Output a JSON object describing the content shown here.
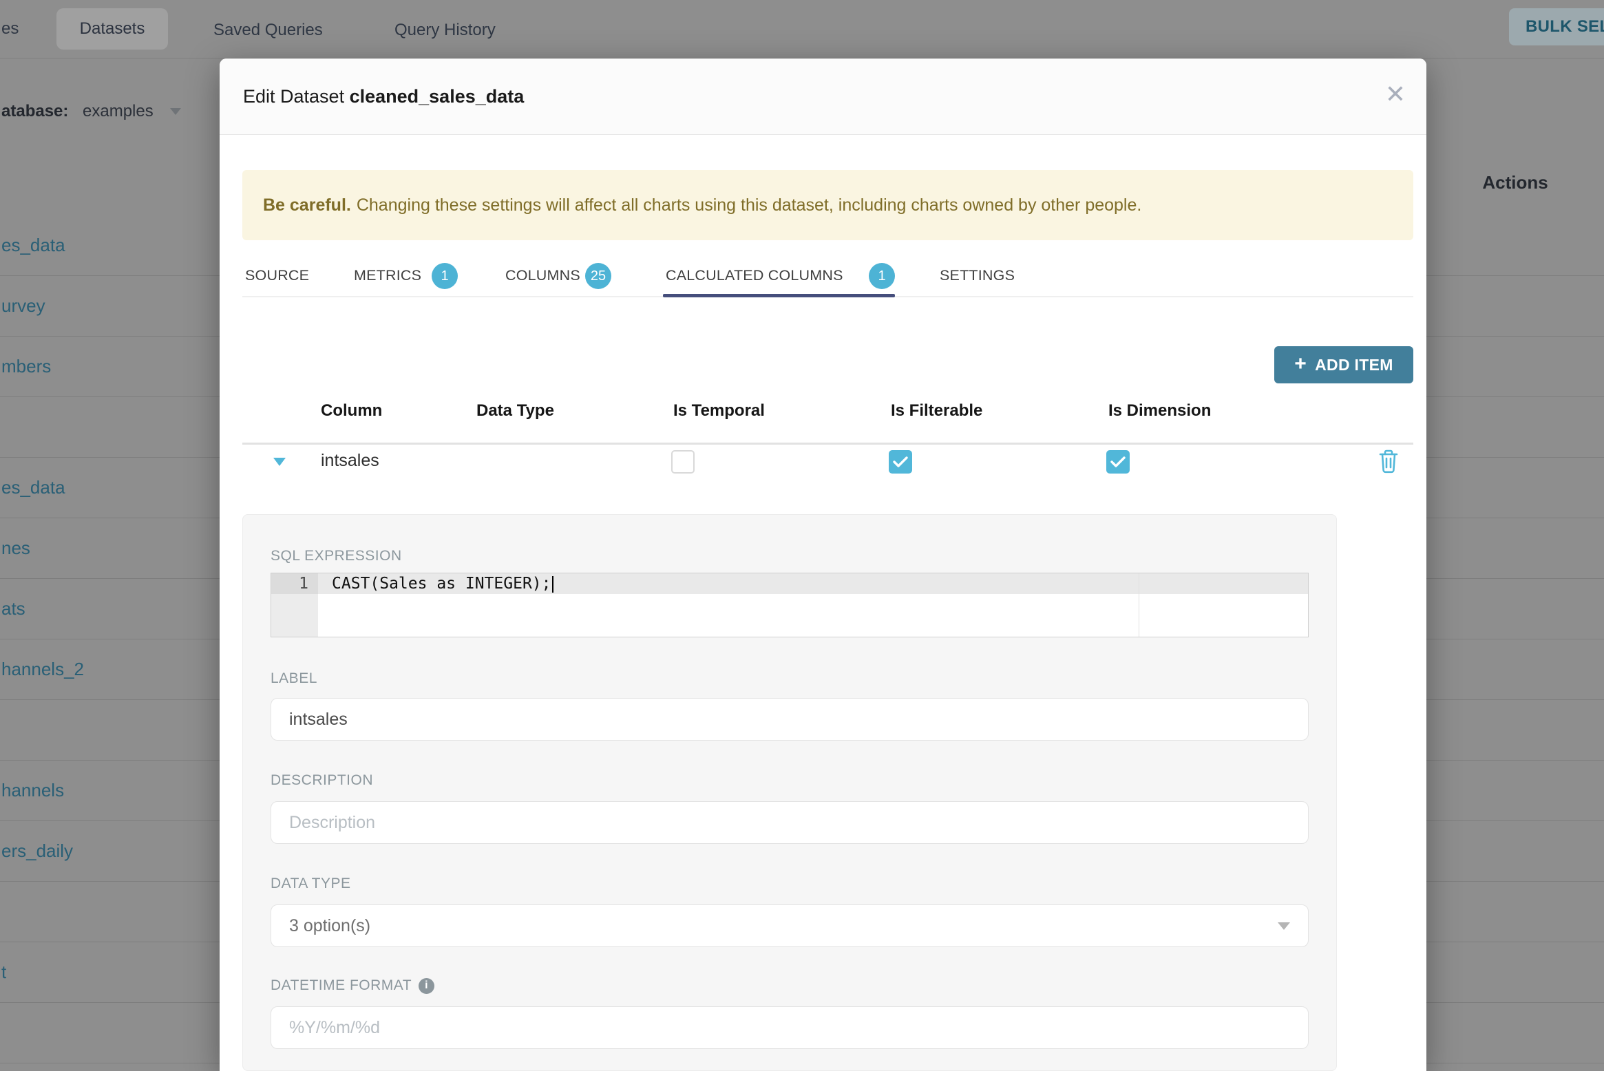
{
  "colors": {
    "accent_cyan": "#51b7d9",
    "badge": "#4db3d5",
    "tab_underline": "#454e7c",
    "add_button": "#427f9b",
    "warning_bg": "#faf5e1",
    "warning_text": "#7f6d28",
    "link_teal_dimmed": "#295f76"
  },
  "background": {
    "nav": {
      "clipped_left_label": "es",
      "tabs": [
        {
          "label": "Datasets"
        },
        {
          "label": "Saved Queries"
        },
        {
          "label": "Query History"
        }
      ],
      "bulk_select_label": "BULK SELEC"
    },
    "filter": {
      "label": "atabase:",
      "value": "examples"
    },
    "actions_header": "Actions",
    "list_rows": [
      "es_data",
      "urvey",
      "mbers",
      "",
      "es_data",
      "nes",
      "ats",
      "hannels_2",
      "",
      "hannels",
      "ers_daily",
      "",
      "t",
      ""
    ]
  },
  "modal": {
    "title_prefix": "Edit Dataset",
    "title_name": "cleaned_sales_data",
    "close_glyph": "✕",
    "warning": {
      "bold": "Be careful.",
      "text": "Changing these settings will affect all charts using this dataset, including charts owned by other people."
    },
    "tabs": [
      {
        "label": "SOURCE",
        "badge": ""
      },
      {
        "label": "METRICS",
        "badge": "1"
      },
      {
        "label": "COLUMNS",
        "badge": "25"
      },
      {
        "label": "CALCULATED COLUMNS",
        "badge": "1"
      },
      {
        "label": "SETTINGS",
        "badge": ""
      }
    ],
    "active_tab": "CALCULATED COLUMNS",
    "add_item_label": "ADD ITEM",
    "add_item_plus": "+",
    "table": {
      "headers": [
        "Column",
        "Data Type",
        "Is Temporal",
        "Is Filterable",
        "Is Dimension"
      ],
      "row": {
        "column": "intsales",
        "is_temporal": false,
        "is_filterable": true,
        "is_dimension": true
      }
    },
    "detail": {
      "sql_label": "SQL EXPRESSION",
      "sql_line_number": "1",
      "sql_code": "CAST(Sales as INTEGER);",
      "label_label": "LABEL",
      "label_value": "intsales",
      "description_label": "DESCRIPTION",
      "description_placeholder": "Description",
      "datatype_label": "DATA TYPE",
      "datatype_value": "3 option(s)",
      "datetime_label": "DATETIME FORMAT",
      "datetime_info_glyph": "i",
      "datetime_placeholder": "%Y/%m/%d"
    }
  }
}
